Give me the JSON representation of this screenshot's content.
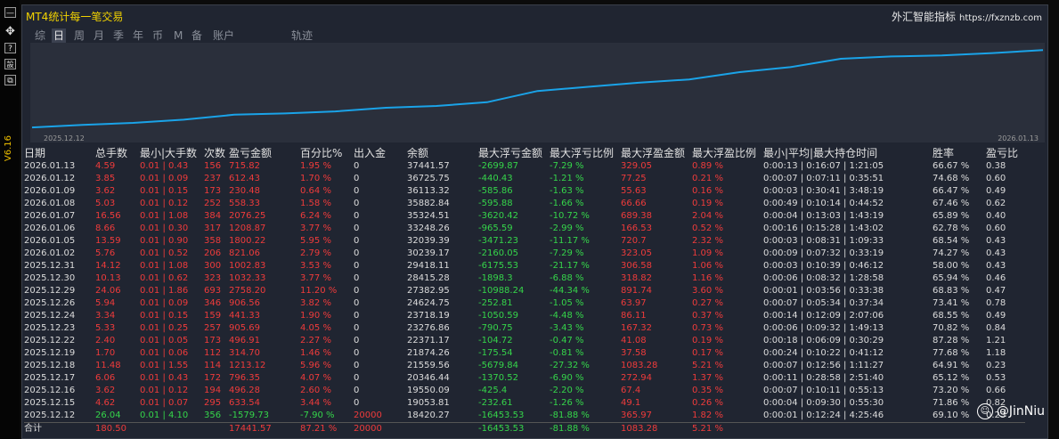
{
  "app": {
    "title": "MT4统计每一笔交易",
    "brand": "外汇智能指标",
    "url": "https://fxznzb.com",
    "version": "V6.16"
  },
  "sidebar_icons": [
    "minimize-icon",
    "move-icon",
    "help-icon",
    "settings-icon",
    "restore-icon"
  ],
  "tabs": [
    "综",
    "日",
    "周",
    "月",
    "季",
    "年",
    "币",
    "M",
    "备",
    "账户",
    "轨迹"
  ],
  "active_tab": "日",
  "chart_data": {
    "type": "line",
    "x_start": "2025.12.12",
    "x_end": "2026.01.13",
    "series_color": "#1aa3e8",
    "values": [
      18420.27,
      19053.81,
      19550.09,
      20346.44,
      21559.56,
      21874.26,
      22371.17,
      23276.86,
      23718.19,
      24624.75,
      27382.95,
      28415.28,
      29418.11,
      30239.17,
      32039.39,
      33248.26,
      35324.51,
      35882.84,
      36113.32,
      36725.75,
      37441.57
    ]
  },
  "table": {
    "headers": [
      "日期",
      "总手数",
      "最小|大手数",
      "次数",
      "盈亏金额",
      "百分比%",
      "出入金",
      "余额",
      "最大浮亏金额",
      "最大浮亏比例",
      "最大浮盈金额",
      "最大浮盈比例",
      "最小|平均|最大持仓时间",
      "胜率",
      "盈亏比"
    ],
    "rows": [
      [
        "2026.01.13",
        "4.59",
        "0.01 | 0.43",
        "156",
        "715.82",
        "1.95 %",
        "0",
        "37441.57",
        "-2699.87",
        "-7.29 %",
        "329.05",
        "0.89 %",
        "0:00:13 | 0:16:07 | 1:21:05",
        "66.67 %",
        "0.38"
      ],
      [
        "2026.01.12",
        "3.85",
        "0.01 | 0.09",
        "237",
        "612.43",
        "1.70 %",
        "0",
        "36725.75",
        "-440.43",
        "-1.21 %",
        "77.25",
        "0.21 %",
        "0:00:07 | 0:07:11 | 0:35:51",
        "74.68 %",
        "0.60"
      ],
      [
        "2026.01.09",
        "3.62",
        "0.01 | 0.15",
        "173",
        "230.48",
        "0.64 %",
        "0",
        "36113.32",
        "-585.86",
        "-1.63 %",
        "55.63",
        "0.16 %",
        "0:00:03 | 0:30:41 | 3:48:19",
        "66.47 %",
        "0.49"
      ],
      [
        "2026.01.08",
        "5.03",
        "0.01 | 0.12",
        "252",
        "558.33",
        "1.58 %",
        "0",
        "35882.84",
        "-595.88",
        "-1.66 %",
        "66.66",
        "0.19 %",
        "0:00:49 | 0:10:14 | 0:44:52",
        "67.46 %",
        "0.62"
      ],
      [
        "2026.01.07",
        "16.56",
        "0.01 | 1.08",
        "384",
        "2076.25",
        "6.24 %",
        "0",
        "35324.51",
        "-3620.42",
        "-10.72 %",
        "689.38",
        "2.04 %",
        "0:00:04 | 0:13:03 | 1:43:19",
        "65.89 %",
        "0.40"
      ],
      [
        "2026.01.06",
        "8.66",
        "0.01 | 0.30",
        "317",
        "1208.87",
        "3.77 %",
        "0",
        "33248.26",
        "-965.59",
        "-2.99 %",
        "166.53",
        "0.52 %",
        "0:00:16 | 0:15:28 | 1:43:02",
        "62.78 %",
        "0.60"
      ],
      [
        "2026.01.05",
        "13.59",
        "0.01 | 0.90",
        "358",
        "1800.22",
        "5.95 %",
        "0",
        "32039.39",
        "-3471.23",
        "-11.17 %",
        "720.7",
        "2.32 %",
        "0:00:03 | 0:08:31 | 1:09:33",
        "68.54 %",
        "0.43"
      ],
      [
        "2026.01.02",
        "5.76",
        "0.01 | 0.52",
        "206",
        "821.06",
        "2.79 %",
        "0",
        "30239.17",
        "-2160.05",
        "-7.29 %",
        "323.05",
        "1.09 %",
        "0:00:09 | 0:07:32 | 0:33:19",
        "74.27 %",
        "0.43"
      ],
      [
        "2025.12.31",
        "14.12",
        "0.01 | 1.08",
        "300",
        "1002.83",
        "3.53 %",
        "0",
        "29418.11",
        "-6175.53",
        "-21.17 %",
        "306.58",
        "1.06 %",
        "0:00:03 | 0:10:39 | 0:46:12",
        "58.00 %",
        "0.43"
      ],
      [
        "2025.12.30",
        "10.13",
        "0.01 | 0.62",
        "323",
        "1032.33",
        "3.77 %",
        "0",
        "28415.28",
        "-1898.3",
        "-6.88 %",
        "318.82",
        "1.16 %",
        "0:00:06 | 0:08:32 | 1:28:58",
        "65.94 %",
        "0.46"
      ],
      [
        "2025.12.29",
        "24.06",
        "0.01 | 1.86",
        "693",
        "2758.20",
        "11.20 %",
        "0",
        "27382.95",
        "-10988.24",
        "-44.34 %",
        "891.74",
        "3.60 %",
        "0:00:01 | 0:03:56 | 0:33:38",
        "68.83 %",
        "0.47"
      ],
      [
        "2025.12.26",
        "5.94",
        "0.01 | 0.09",
        "346",
        "906.56",
        "3.82 %",
        "0",
        "24624.75",
        "-252.81",
        "-1.05 %",
        "63.97",
        "0.27 %",
        "0:00:07 | 0:05:34 | 0:37:34",
        "73.41 %",
        "0.78"
      ],
      [
        "2025.12.24",
        "3.34",
        "0.01 | 0.15",
        "159",
        "441.33",
        "1.90 %",
        "0",
        "23718.19",
        "-1050.59",
        "-4.48 %",
        "86.11",
        "0.37 %",
        "0:00:14 | 0:12:09 | 2:07:06",
        "68.55 %",
        "0.49"
      ],
      [
        "2025.12.23",
        "5.33",
        "0.01 | 0.25",
        "257",
        "905.69",
        "4.05 %",
        "0",
        "23276.86",
        "-790.75",
        "-3.43 %",
        "167.32",
        "0.73 %",
        "0:00:06 | 0:09:32 | 1:49:13",
        "70.82 %",
        "0.84"
      ],
      [
        "2025.12.22",
        "2.40",
        "0.01 | 0.05",
        "173",
        "496.91",
        "2.27 %",
        "0",
        "22371.17",
        "-104.72",
        "-0.47 %",
        "41.08",
        "0.19 %",
        "0:00:18 | 0:06:09 | 0:30:29",
        "87.28 %",
        "1.21"
      ],
      [
        "2025.12.19",
        "1.70",
        "0.01 | 0.06",
        "112",
        "314.70",
        "1.46 %",
        "0",
        "21874.26",
        "-175.54",
        "-0.81 %",
        "37.58",
        "0.17 %",
        "0:00:24 | 0:10:22 | 0:41:12",
        "77.68 %",
        "1.18"
      ],
      [
        "2025.12.18",
        "11.48",
        "0.01 | 1.55",
        "114",
        "1213.12",
        "5.96 %",
        "0",
        "21559.56",
        "-5679.84",
        "-27.32 %",
        "1083.28",
        "5.21 %",
        "0:00:07 | 0:12:56 | 1:11:27",
        "64.91 %",
        "0.23"
      ],
      [
        "2025.12.17",
        "6.06",
        "0.01 | 0.43",
        "172",
        "796.35",
        "4.07 %",
        "0",
        "20346.44",
        "-1370.52",
        "-6.90 %",
        "272.94",
        "1.37 %",
        "0:00:11 | 0:28:58 | 2:51:40",
        "65.12 %",
        "0.53"
      ],
      [
        "2025.12.16",
        "3.62",
        "0.01 | 0.12",
        "194",
        "496.28",
        "2.60 %",
        "0",
        "19550.09",
        "-425.4",
        "-2.20 %",
        "67.4",
        "0.35 %",
        "0:00:07 | 0:10:11 | 0:55:13",
        "73.20 %",
        "0.66"
      ],
      [
        "2025.12.15",
        "4.62",
        "0.01 | 0.07",
        "295",
        "633.54",
        "3.44 %",
        "0",
        "19053.81",
        "-232.61",
        "-1.26 %",
        "49.1",
        "0.26 %",
        "0:00:04 | 0:09:30 | 0:55:30",
        "71.86 %",
        "0.82"
      ],
      [
        "2025.12.12",
        "26.04",
        "0.01 | 4.10",
        "356",
        "-1579.73",
        "-7.90 %",
        "20000",
        "18420.27",
        "-16453.53",
        "-81.88 %",
        "365.97",
        "1.82 %",
        "0:00:01 | 0:12:24 | 4:25:46",
        "69.10 %",
        "0.23"
      ]
    ],
    "total": [
      "合计",
      "180.50",
      "",
      "",
      "17441.57",
      "87.21 %",
      "20000",
      "",
      "-16453.53",
      "-81.88 %",
      "1083.28",
      "5.21 %",
      "",
      "",
      ""
    ]
  },
  "watermark": "@JinNiu"
}
